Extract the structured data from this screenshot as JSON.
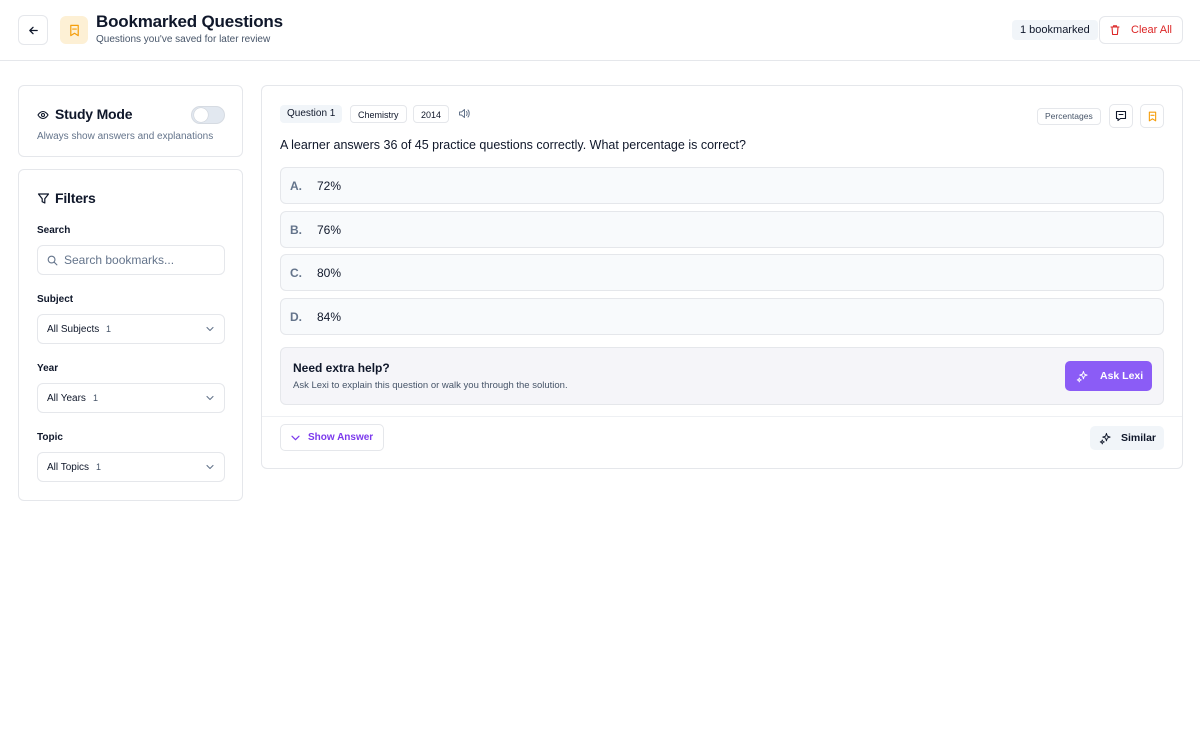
{
  "header": {
    "title": "Bookmarked Questions",
    "subtitle": "Questions you've saved for later review",
    "bookmark_count_label": "1 bookmarked",
    "clear_all_label": "Clear All"
  },
  "study_mode": {
    "title": "Study Mode",
    "description": "Always show answers and explanations",
    "enabled": false
  },
  "filters": {
    "title": "Filters",
    "search": {
      "label": "Search",
      "placeholder": "Search bookmarks...",
      "value": ""
    },
    "subject": {
      "label": "Subject",
      "value": "All Subjects",
      "count": "1"
    },
    "year": {
      "label": "Year",
      "value": "All Years",
      "count": "1"
    },
    "topic": {
      "label": "Topic",
      "value": "All Topics",
      "count": "1"
    }
  },
  "question_card": {
    "number_label": "Question 1",
    "subject_tag": "Chemistry",
    "year_tag": "2014",
    "topic_badge": "Percentages",
    "question_text": "A learner answers 36 of 45 practice questions correctly. What percentage is correct?",
    "options": [
      {
        "label": "A.",
        "text": "72%"
      },
      {
        "label": "B.",
        "text": "76%"
      },
      {
        "label": "C.",
        "text": "80%"
      },
      {
        "label": "D.",
        "text": "84%"
      }
    ],
    "help": {
      "title": "Need extra help?",
      "description": "Ask Lexi to explain this question or walk you through the solution.",
      "button_label": "Ask Lexi"
    },
    "show_answer_label": "Show Answer",
    "similar_label": "Similar"
  },
  "colors": {
    "accent": "#8b5cf6",
    "danger": "#dc2626",
    "bookmark": "#f59e0b"
  },
  "icons": [
    "arrow-left-icon",
    "bookmark-icon",
    "trash-icon",
    "eye-icon",
    "filter-icon",
    "search-icon",
    "chevron-down-icon",
    "speaker-icon",
    "comment-icon",
    "sparkles-icon"
  ]
}
